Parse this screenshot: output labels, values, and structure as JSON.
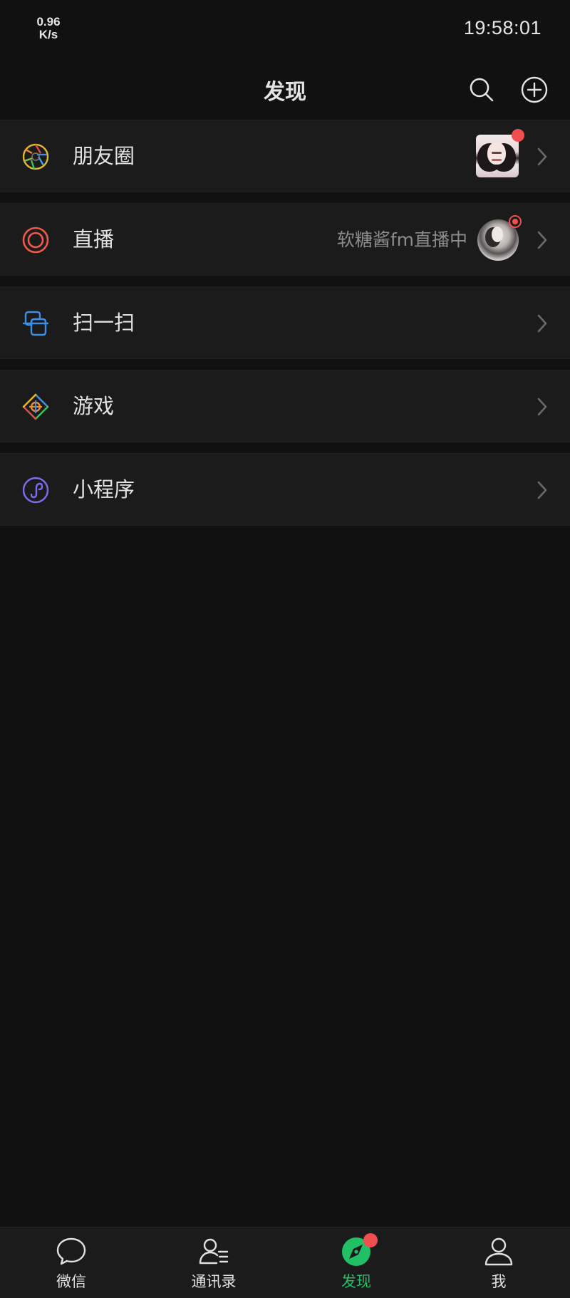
{
  "status_bar": {
    "net_speed_value": "0.96",
    "net_speed_unit": "K/s",
    "time": "19:58:01"
  },
  "header": {
    "title": "发现",
    "search_icon": "search-icon",
    "add_icon": "plus-circle-icon"
  },
  "menu": {
    "items": [
      {
        "label": "朋友圈",
        "icon": "moments-aperture-icon",
        "has_thumbnail": true,
        "has_red_dot": true
      },
      {
        "label": "直播",
        "icon": "live-ring-icon",
        "subtitle": "软糖酱fm直播中",
        "has_avatar": true,
        "live_indicator": true
      },
      {
        "label": "扫一扫",
        "icon": "scan-icon"
      },
      {
        "label": "游戏",
        "icon": "game-diamond-icon"
      },
      {
        "label": "小程序",
        "icon": "mini-program-icon"
      }
    ]
  },
  "tabbar": {
    "tabs": [
      {
        "label": "微信",
        "icon": "chat-bubble-icon",
        "active": false
      },
      {
        "label": "通讯录",
        "icon": "contacts-icon",
        "active": false
      },
      {
        "label": "发现",
        "icon": "compass-icon",
        "active": true,
        "badge": true
      },
      {
        "label": "我",
        "icon": "person-icon",
        "active": false
      }
    ]
  },
  "colors": {
    "background": "#111111",
    "row_background": "#1b1b1b",
    "accent_green": "#22c065",
    "badge_red": "#f14f4f",
    "text_primary": "#e2e2e2",
    "text_secondary": "#8c8c8c"
  }
}
